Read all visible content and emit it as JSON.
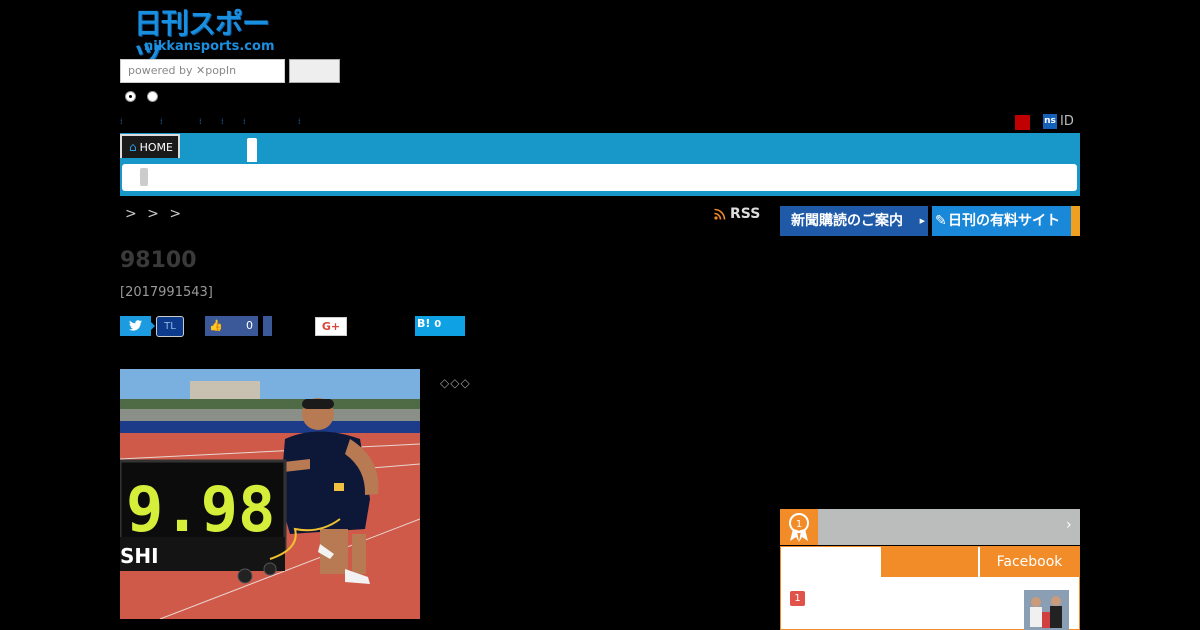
{
  "header": {
    "logo_text": "日刊スポーツ",
    "logo_subtext": "nikkansports.com",
    "search_placeholder": "powered by ✕popIn",
    "search_button": "",
    "id_badge": "ns",
    "id_label": "ID"
  },
  "nav": {
    "home_label": "HOME"
  },
  "breadcrumb": "> > >",
  "rss_label": "RSS",
  "banners": {
    "subscribe": "新聞購読のご案内",
    "paid_sites": "日刊の有料サイト"
  },
  "article": {
    "title": "98100",
    "date": "[2017991543]",
    "caption_glyphs": "◇◇◇",
    "photo_scoreboard": "9.98",
    "photo_banner_text": "SHI"
  },
  "share": {
    "tweet_icon": "twitter-icon",
    "tl_label": "TL",
    "like_count": "0",
    "gplus_label": "G+",
    "hatena_label": "B!",
    "hatena_count": "0"
  },
  "ranking": {
    "facebook_tab": "Facebook",
    "first_rank": "1",
    "chevron": "›"
  },
  "colors": {
    "nav_blue": "#1898c8",
    "subscribe_blue": "#1e5aa8",
    "ranking_orange": "#f28c28"
  }
}
